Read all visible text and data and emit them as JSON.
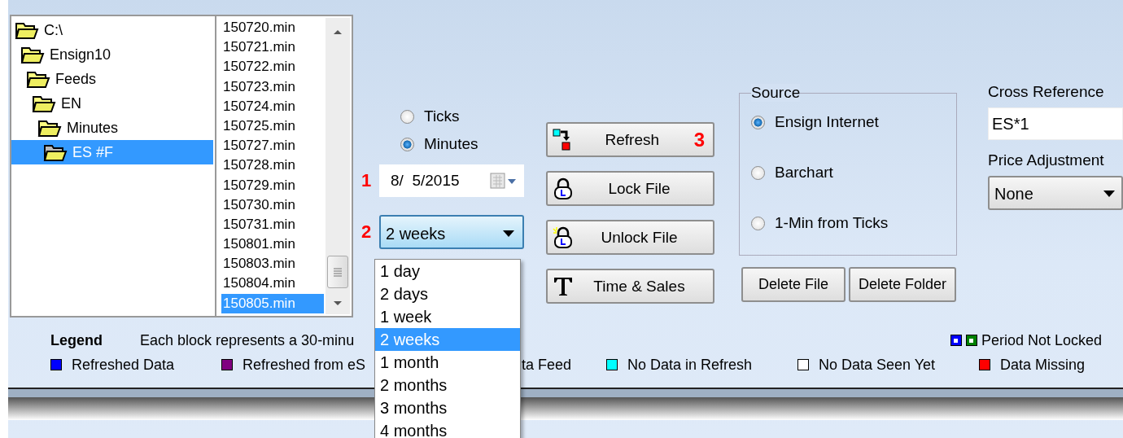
{
  "folder_tree": [
    {
      "label": "C:\\",
      "selected": false,
      "children": [
        {
          "label": "Ensign10",
          "selected": false,
          "children": [
            {
              "label": "Feeds",
              "selected": false,
              "children": [
                {
                  "label": "EN",
                  "selected": false,
                  "children": [
                    {
                      "label": "Minutes",
                      "selected": false,
                      "children": [
                        {
                          "label": "ES #F",
                          "selected": true
                        }
                      ]
                    }
                  ]
                }
              ]
            }
          ]
        }
      ]
    }
  ],
  "file_list": [
    {
      "label": "150720.min",
      "selected": false
    },
    {
      "label": "150721.min",
      "selected": false
    },
    {
      "label": "150722.min",
      "selected": false
    },
    {
      "label": "150723.min",
      "selected": false
    },
    {
      "label": "150724.min",
      "selected": false
    },
    {
      "label": "150725.min",
      "selected": false
    },
    {
      "label": "150727.min",
      "selected": false
    },
    {
      "label": "150728.min",
      "selected": false
    },
    {
      "label": "150729.min",
      "selected": false
    },
    {
      "label": "150730.min",
      "selected": false
    },
    {
      "label": "150731.min",
      "selected": false
    },
    {
      "label": "150801.min",
      "selected": false
    },
    {
      "label": "150803.min",
      "selected": false
    },
    {
      "label": "150804.min",
      "selected": false
    },
    {
      "label": "150805.min",
      "selected": true
    }
  ],
  "data_type": [
    {
      "label": "Ticks",
      "selected": false
    },
    {
      "label": "Minutes",
      "selected": true
    }
  ],
  "date_field": {
    "marker": "1",
    "value": "8/  5/2015"
  },
  "period_combo": {
    "marker": "2",
    "value": "2 weeks",
    "expanded": true,
    "options": [
      {
        "label": "1 day",
        "selected": false
      },
      {
        "label": "2 days",
        "selected": false
      },
      {
        "label": "1 week",
        "selected": false
      },
      {
        "label": "2 weeks",
        "selected": true
      },
      {
        "label": "1 month",
        "selected": false
      },
      {
        "label": "2 months",
        "selected": false
      },
      {
        "label": "3 months",
        "selected": false
      },
      {
        "label": "4 months",
        "selected": false
      }
    ]
  },
  "buttons": [
    {
      "label": "Refresh",
      "kind": "refresh",
      "marker": "3"
    },
    {
      "label": "Lock File",
      "kind": "lock"
    },
    {
      "label": "Unlock File",
      "kind": "unlock"
    },
    {
      "label": "Time & Sales",
      "kind": "text"
    }
  ],
  "source": {
    "title": "Source",
    "options": [
      {
        "label": "Ensign Internet",
        "selected": true
      },
      {
        "label": "Barchart",
        "selected": false
      },
      {
        "label": "1-Min from Ticks",
        "selected": false
      }
    ],
    "buttons": [
      "Delete File",
      "Delete Folder"
    ]
  },
  "cross_reference": {
    "label": "Cross Reference",
    "value": "ES*1"
  },
  "price_adjustment": {
    "label": "Price Adjustment",
    "value": "None"
  },
  "legend": {
    "title": "Legend",
    "description": "Each block represents a 30-minu",
    "period_not_locked": {
      "label": "Period Not Locked",
      "swatches": [
        {
          "color": "#0000ff"
        },
        {
          "color": "#008000"
        }
      ]
    },
    "items": [
      {
        "label": "Refreshed Data",
        "color": "#0000ff"
      },
      {
        "label": "Refreshed from eS",
        "color": "#800080"
      },
      {
        "label": "ta Feed"
      },
      {
        "label": "No Data in Refresh",
        "color": "#00ffff"
      },
      {
        "label": "No Data Seen Yet",
        "color": "#ffffff"
      },
      {
        "label": "Data Missing",
        "color": "#ff0000"
      }
    ]
  }
}
